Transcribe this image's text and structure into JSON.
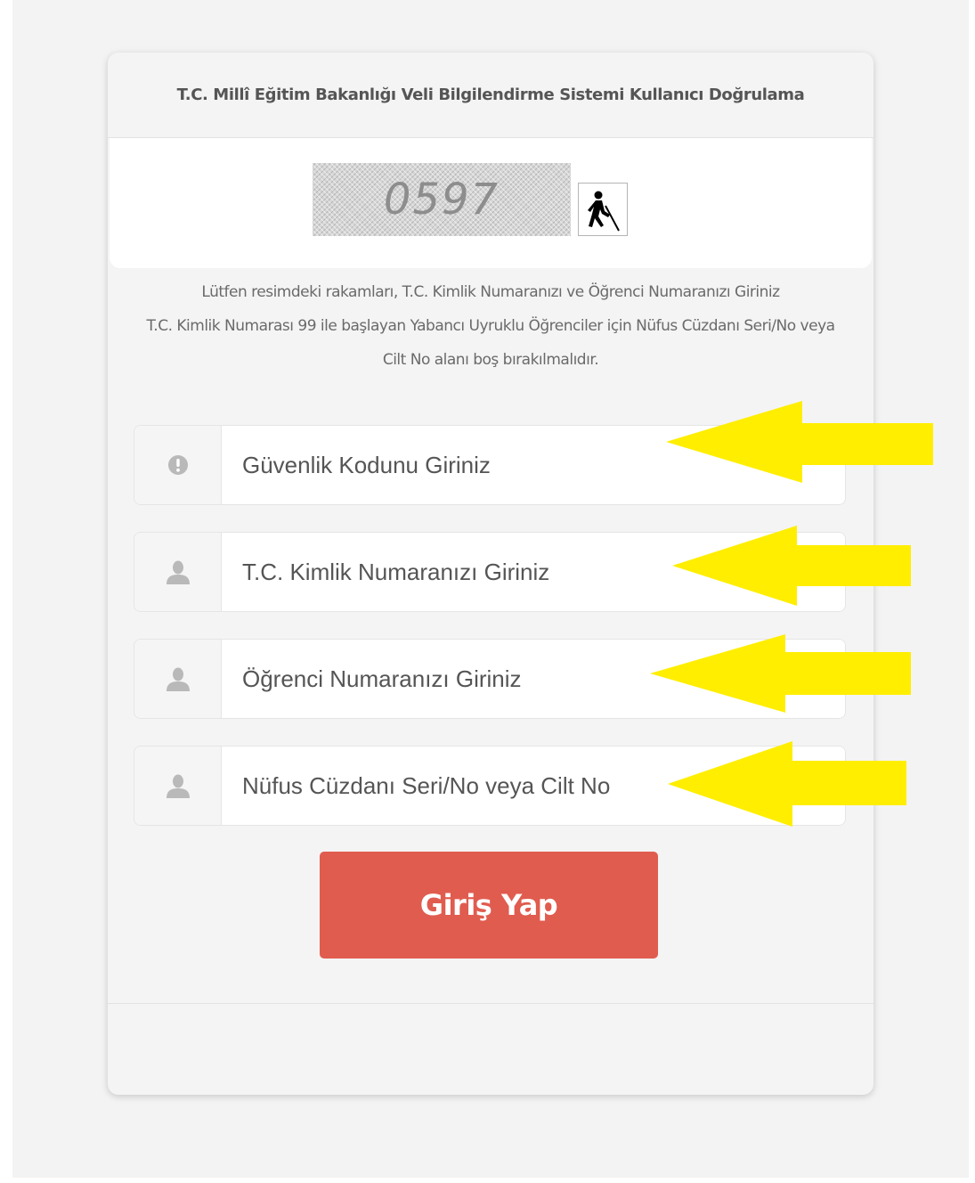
{
  "header": {
    "title": "T.C. Millî Eğitim Bakanlığı  Veli Bilgilendirme Sistemi Kullanıcı Doğrulama"
  },
  "captcha": {
    "code": "0597",
    "audio_icon": "accessibility-blind-icon"
  },
  "instructions": {
    "line1": "Lütfen resimdeki rakamları, T.C. Kimlik Numaranızı ve Öğrenci Numaranızı Giriniz",
    "line2": "T.C. Kimlik Numarası 99 ile başlayan Yabancı Uyruklu Öğrenciler için Nüfus Cüzdanı Seri/No veya Cilt No alanı boş bırakılmalıdır."
  },
  "form": {
    "fields": [
      {
        "icon": "exclamation-circle-icon",
        "placeholder": "Güvenlik Kodunu Giriniz",
        "value": ""
      },
      {
        "icon": "user-icon",
        "placeholder": "T.C. Kimlik Numaranızı Giriniz",
        "value": ""
      },
      {
        "icon": "user-icon",
        "placeholder": "Öğrenci Numaranızı Giriniz",
        "value": ""
      },
      {
        "icon": "user-icon",
        "placeholder": "Nüfus Cüzdanı Seri/No veya Cilt No",
        "value": ""
      }
    ],
    "submit_label": "Giriş Yap"
  },
  "annotations": {
    "arrow_color": "#ffee00",
    "arrow_icon": "left-arrow-icon"
  },
  "colors": {
    "button": "#e05c4f",
    "card_background": "#f4f4f4"
  }
}
